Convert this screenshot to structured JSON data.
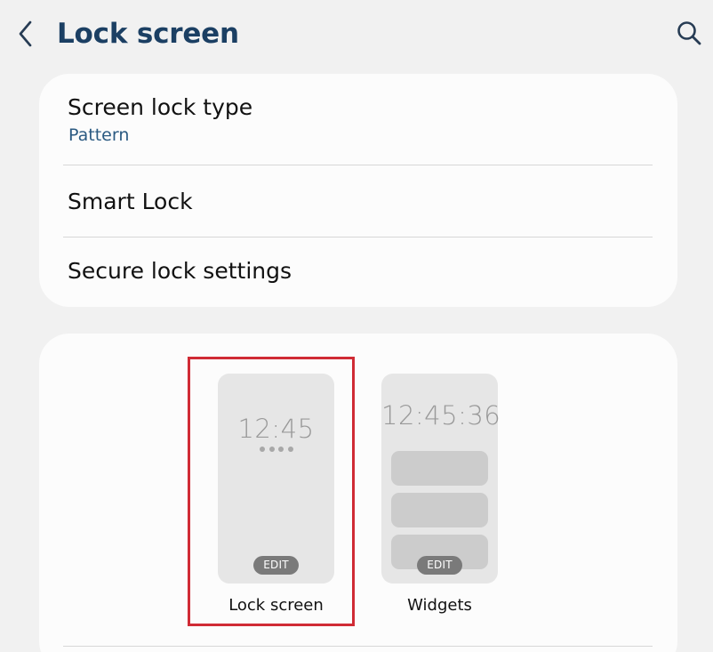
{
  "header": {
    "title": "Lock screen",
    "back_icon": "chevron-left-icon",
    "search_icon": "search-icon"
  },
  "settings": {
    "items": [
      {
        "title": "Screen lock type",
        "subtitle": "Pattern"
      },
      {
        "title": "Smart Lock"
      },
      {
        "title": "Secure lock settings"
      }
    ]
  },
  "previews": {
    "lock_screen": {
      "time": "12:45",
      "edit_label": "EDIT",
      "label": "Lock screen"
    },
    "widgets": {
      "time": "12:45:36",
      "edit_label": "EDIT",
      "label": "Widgets"
    }
  },
  "colors": {
    "background": "#f1f1f1",
    "card": "#fcfcfc",
    "title": "#1b3f63",
    "subtitle": "#2b5a82",
    "selection": "#d02b35"
  }
}
